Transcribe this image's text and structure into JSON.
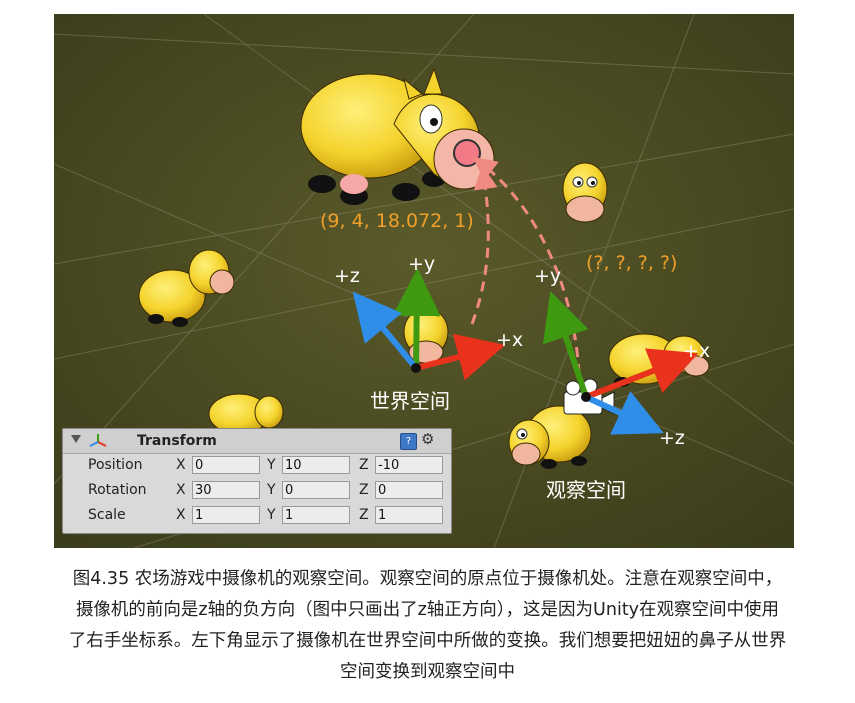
{
  "figure": {
    "world_space_label": "世界空间",
    "view_space_label": "观察空间",
    "nose_world_coords": "(9, 4, 18.072, 1)",
    "nose_view_coords": "(?, ?, ?, ?)",
    "world_axes": {
      "y": "+y",
      "x": "+x",
      "z": "+z"
    },
    "camera_axes": {
      "y": "+y",
      "x": "+x",
      "z": "+z"
    },
    "colors": {
      "x_axis": "#e8321c",
      "y_axis": "#3f9a12",
      "z_axis": "#2f8ee8",
      "dashed_path": "#f08a80",
      "coords": "#f0a028",
      "ground": "#4a4a22",
      "cow_body": "#f4d32c"
    }
  },
  "inspector": {
    "title": "Transform",
    "rows": [
      {
        "label": "Position",
        "x": "0",
        "y": "10",
        "z": "-10"
      },
      {
        "label": "Rotation",
        "x": "30",
        "y": "0",
        "z": "0"
      },
      {
        "label": "Scale",
        "x": "1",
        "y": "1",
        "z": "1"
      }
    ],
    "axis_letters": {
      "x": "X",
      "y": "Y",
      "z": "Z"
    },
    "icons": [
      "transform-axes-icon",
      "help-book-icon",
      "gear-icon"
    ]
  },
  "caption": {
    "lines": [
      "图4.35 农场游戏中摄像机的观察空间。观察空间的原点位于摄像机处。注意在观察空间中，",
      "摄像机的前向是z轴的负方向（图中只画出了z轴正方向），这是因为Unity在观察空间中使用",
      "了右手坐标系。左下角显示了摄像机在世界空间中所做的变换。我们想要把妞妞的鼻子从世界",
      "空间变换到观察空间中"
    ]
  }
}
